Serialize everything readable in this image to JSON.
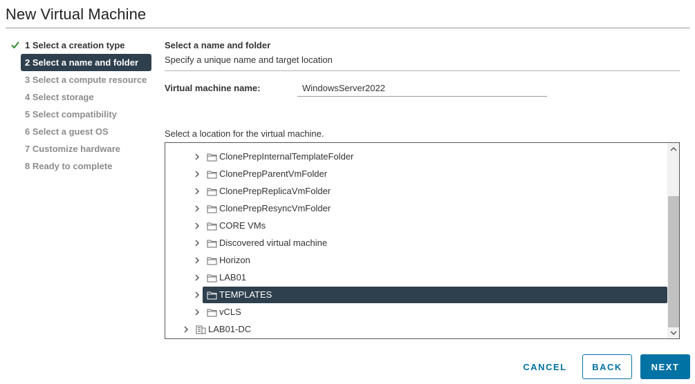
{
  "window": {
    "title": "New Virtual Machine"
  },
  "steps": [
    {
      "label": "1 Select a creation type",
      "state": "done"
    },
    {
      "label": "2 Select a name and folder",
      "state": "active"
    },
    {
      "label": "3 Select a compute resource",
      "state": "pending"
    },
    {
      "label": "4 Select storage",
      "state": "pending"
    },
    {
      "label": "5 Select compatibility",
      "state": "pending"
    },
    {
      "label": "6 Select a guest OS",
      "state": "pending"
    },
    {
      "label": "7 Customize hardware",
      "state": "pending"
    },
    {
      "label": "8 Ready to complete",
      "state": "pending"
    }
  ],
  "main": {
    "title": "Select a name and folder",
    "subtitle": "Specify a unique name and target location",
    "vm_name_label": "Virtual machine name:",
    "vm_name_value": "WindowsServer2022",
    "location_label": "Select a location for the virtual machine."
  },
  "tree": {
    "items": [
      {
        "label": "ClonePrepInternalTemplateFolder",
        "icon": "folder-icon",
        "selected": false
      },
      {
        "label": "ClonePrepParentVmFolder",
        "icon": "folder-icon",
        "selected": false
      },
      {
        "label": "ClonePrepReplicaVmFolder",
        "icon": "folder-icon",
        "selected": false
      },
      {
        "label": "ClonePrepResyncVmFolder",
        "icon": "folder-icon",
        "selected": false
      },
      {
        "label": "CORE VMs",
        "icon": "folder-icon",
        "selected": false
      },
      {
        "label": "Discovered virtual machine",
        "icon": "folder-icon",
        "selected": false
      },
      {
        "label": "Horizon",
        "icon": "folder-icon",
        "selected": false
      },
      {
        "label": "LAB01",
        "icon": "folder-icon",
        "selected": false
      },
      {
        "label": "TEMPLATES",
        "icon": "folder-icon",
        "selected": true
      },
      {
        "label": "vCLS",
        "icon": "folder-icon",
        "selected": false
      },
      {
        "label": "LAB01-DC",
        "icon": "datacenter-icon",
        "selected": false
      }
    ]
  },
  "footer": {
    "cancel_label": "CANCEL",
    "back_label": "BACK",
    "next_label": "NEXT"
  },
  "colors": {
    "accent": "#0072a3",
    "selected_bg": "#2e3f4d",
    "check": "#2e8b2e"
  }
}
